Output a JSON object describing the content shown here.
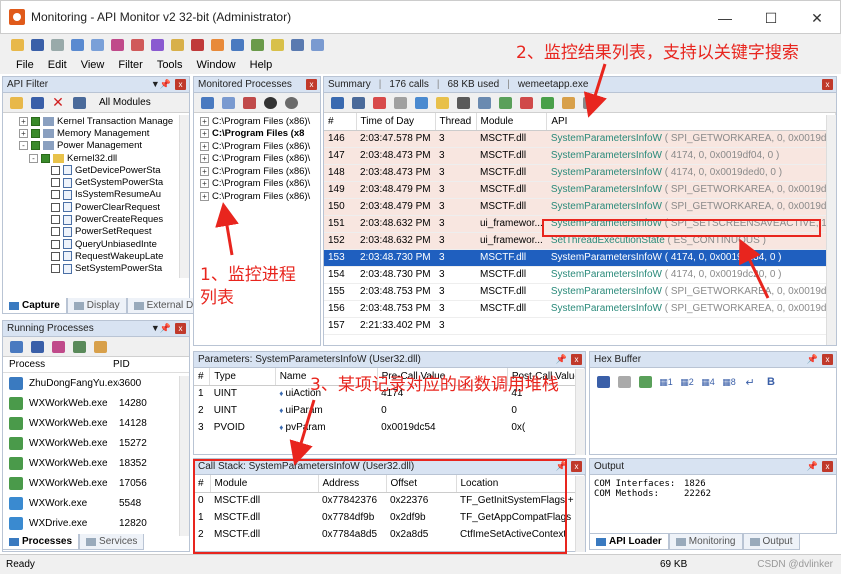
{
  "window": {
    "title": "Monitoring - API Monitor v2 32-bit (Administrator)"
  },
  "menu": [
    "File",
    "Edit",
    "View",
    "Filter",
    "Tools",
    "Window",
    "Help"
  ],
  "api_filter": {
    "title": "API Filter",
    "modules_button": "All Modules",
    "tree": [
      {
        "label": "Kernel Transaction Manage",
        "indent": 1,
        "expand": "+"
      },
      {
        "label": "Memory Management",
        "indent": 1,
        "expand": "+"
      },
      {
        "label": "Power Management",
        "indent": 1,
        "expand": "-"
      },
      {
        "label": "Kernel32.dll",
        "indent": 2,
        "expand": "-",
        "folder": true
      },
      {
        "label": "GetDevicePowerSta",
        "indent": 3
      },
      {
        "label": "GetSystemPowerSta",
        "indent": 3
      },
      {
        "label": "IsSystemResumeAu",
        "indent": 3
      },
      {
        "label": "PowerClearRequest",
        "indent": 3
      },
      {
        "label": "PowerCreateReques",
        "indent": 3
      },
      {
        "label": "PowerSetRequest",
        "indent": 3
      },
      {
        "label": "QueryUnbiasedInte",
        "indent": 3
      },
      {
        "label": "RequestWakeupLate",
        "indent": 3
      },
      {
        "label": "SetSystemPowerSta",
        "indent": 3
      }
    ],
    "tabs": [
      "Capture",
      "Display",
      "External DLL"
    ]
  },
  "monitored": {
    "title": "Monitored Processes",
    "items": [
      "C:\\Program Files (x86)\\",
      "C:\\Program Files (x8",
      "C:\\Program Files (x86)\\",
      "C:\\Program Files (x86)\\",
      "C:\\Program Files (x86)\\",
      "C:\\Program Files (x86)\\",
      "C:\\Program Files (x86)\\"
    ]
  },
  "summary": {
    "title": "Summary",
    "calls": "176 calls",
    "used": "68 KB used",
    "process": "wemeetapp.exe",
    "columns": [
      "#",
      "Time of Day",
      "Thread",
      "Module",
      "API"
    ],
    "rows": [
      {
        "n": "146",
        "time": "2:03:47.578 PM",
        "thread": "3",
        "module": "MSCTF.dll",
        "fn": "SystemParametersInfoW",
        "args": " ( SPI_GETWORKAREA, 0, ",
        "addr": "0x0019d9cc, 0 )",
        "style": "pink"
      },
      {
        "n": "147",
        "time": "2:03:48.473 PM",
        "thread": "3",
        "module": "MSCTF.dll",
        "fn": "SystemParametersInfoW",
        "args": " ( 4174, 0, ",
        "addr": "0x0019df04, 0 )",
        "style": "pink"
      },
      {
        "n": "148",
        "time": "2:03:48.473 PM",
        "thread": "3",
        "module": "MSCTF.dll",
        "fn": "SystemParametersInfoW",
        "args": " ( 4174, 0, ",
        "addr": "0x0019ded0, 0 )",
        "style": "pink"
      },
      {
        "n": "149",
        "time": "2:03:48.479 PM",
        "thread": "3",
        "module": "MSCTF.dll",
        "fn": "SystemParametersInfoW",
        "args": " ( SPI_GETWORKAREA, 0, ",
        "addr": "0x0019db44, 0 )",
        "style": "pink"
      },
      {
        "n": "150",
        "time": "2:03:48.479 PM",
        "thread": "3",
        "module": "MSCTF.dll",
        "fn": "SystemParametersInfoW",
        "args": " ( SPI_GETWORKAREA, 0, ",
        "addr": "0x0019da6c, 0 )",
        "style": "pink"
      },
      {
        "n": "151",
        "time": "2:03:48.632 PM",
        "thread": "3",
        "module": "ui_framewor...",
        "fn": "SystemParametersInfoW",
        "args": " ( SPI_SETSCREENSAVEACTIVE, 1, ",
        "addr": "NULL, 0 )",
        "style": "pink"
      },
      {
        "n": "152",
        "time": "2:03:48.632 PM",
        "thread": "3",
        "module": "ui_framewor...",
        "fn": "SetThreadExecutionState",
        "args": " ( ES_CONTINUOUS )",
        "addr": "",
        "style": "pink"
      },
      {
        "n": "153",
        "time": "2:03:48.730 PM",
        "thread": "3",
        "module": "MSCTF.dll",
        "fn": "SystemParametersInfoW",
        "args": " ( 4174, 0, ",
        "addr": "0x0019dc54, 0 )",
        "style": "sel"
      },
      {
        "n": "154",
        "time": "2:03:48.730 PM",
        "thread": "3",
        "module": "MSCTF.dll",
        "fn": "SystemParametersInfoW",
        "args": " ( 4174, 0, ",
        "addr": "0x0019dc20, 0 )",
        "style": "plain"
      },
      {
        "n": "155",
        "time": "2:03:48.753 PM",
        "thread": "3",
        "module": "MSCTF.dll",
        "fn": "SystemParametersInfoW",
        "args": " ( SPI_GETWORKAREA, 0, ",
        "addr": "0x0019db44, 0 )",
        "style": "plain"
      },
      {
        "n": "156",
        "time": "2:03:48.753 PM",
        "thread": "3",
        "module": "MSCTF.dll",
        "fn": "SystemParametersInfoW",
        "args": " ( SPI_GETWORKAREA, 0, ",
        "addr": "0x0019da6c, 0 )",
        "style": "plain"
      },
      {
        "n": "157",
        "time": "2:21:33.402 PM",
        "thread": "3",
        "module": "",
        "fn": "",
        "args": "",
        "addr": "",
        "style": "plain"
      }
    ]
  },
  "running": {
    "title": "Running Processes",
    "columns": [
      "Process",
      "PID"
    ],
    "items": [
      {
        "name": "ZhuDongFangYu.exe",
        "pid": "3600"
      },
      {
        "name": "WXWorkWeb.exe",
        "pid": "14280"
      },
      {
        "name": "WXWorkWeb.exe",
        "pid": "14128"
      },
      {
        "name": "WXWorkWeb.exe",
        "pid": "15272"
      },
      {
        "name": "WXWorkWeb.exe",
        "pid": "18352"
      },
      {
        "name": "WXWorkWeb.exe",
        "pid": "17056"
      },
      {
        "name": "WXWork.exe",
        "pid": "5548"
      },
      {
        "name": "WXDrive.exe",
        "pid": "12820"
      }
    ],
    "tabs": [
      "Processes",
      "Services"
    ]
  },
  "parameters": {
    "title": "Parameters: SystemParametersInfoW (User32.dll)",
    "columns": [
      "#",
      "Type",
      "Name",
      "Pre-Call Value",
      "Post-Call Value"
    ],
    "rows": [
      {
        "n": "1",
        "type": "UINT",
        "name": "uiAction",
        "pre": "4174",
        "post": "41"
      },
      {
        "n": "2",
        "type": "UINT",
        "name": "uiParam",
        "pre": "0",
        "post": "0"
      },
      {
        "n": "3",
        "type": "PVOID",
        "name": "pvParam",
        "pre": "0x0019dc54",
        "post": "0x("
      }
    ]
  },
  "hexbuffer": {
    "title": "Hex Buffer"
  },
  "callstack": {
    "title": "Call Stack: SystemParametersInfoW (User32.dll)",
    "columns": [
      "#",
      "Module",
      "Address",
      "Offset",
      "Location"
    ],
    "rows": [
      {
        "n": "0",
        "module": "MSCTF.dll",
        "addr": "0x77842376",
        "off": "0x22376",
        "loc": "TF_GetInitSystemFlags + 0"
      },
      {
        "n": "1",
        "module": "MSCTF.dll",
        "addr": "0x7784df9b",
        "off": "0x2df9b",
        "loc": "TF_GetAppCompatFlags"
      },
      {
        "n": "2",
        "module": "MSCTF.dll",
        "addr": "0x7784a8d5",
        "off": "0x2a8d5",
        "loc": "CtfImeSetActiveContext"
      }
    ]
  },
  "output": {
    "title": "Output",
    "lines": [
      [
        "COM Interfaces:",
        "1826"
      ],
      [
        "COM Methods:",
        "22262"
      ]
    ],
    "tabs": [
      "API Loader",
      "Monitoring",
      "Output"
    ]
  },
  "status": {
    "left": "Ready",
    "mem": "69 KB"
  },
  "annotations": {
    "a1": "1、监控进程",
    "a1b": "列表",
    "a2": "2、监控结果列表，支持以关键字搜索",
    "a3": "3、某项记录对应的函数调用堆栈"
  },
  "watermark": "CSDN @dvlinker",
  "colors": {
    "annotation": "#e8251e",
    "selection": "#1f5fbf",
    "row_pink": "#f8e6e0",
    "api_text": "#2a8a7a"
  }
}
